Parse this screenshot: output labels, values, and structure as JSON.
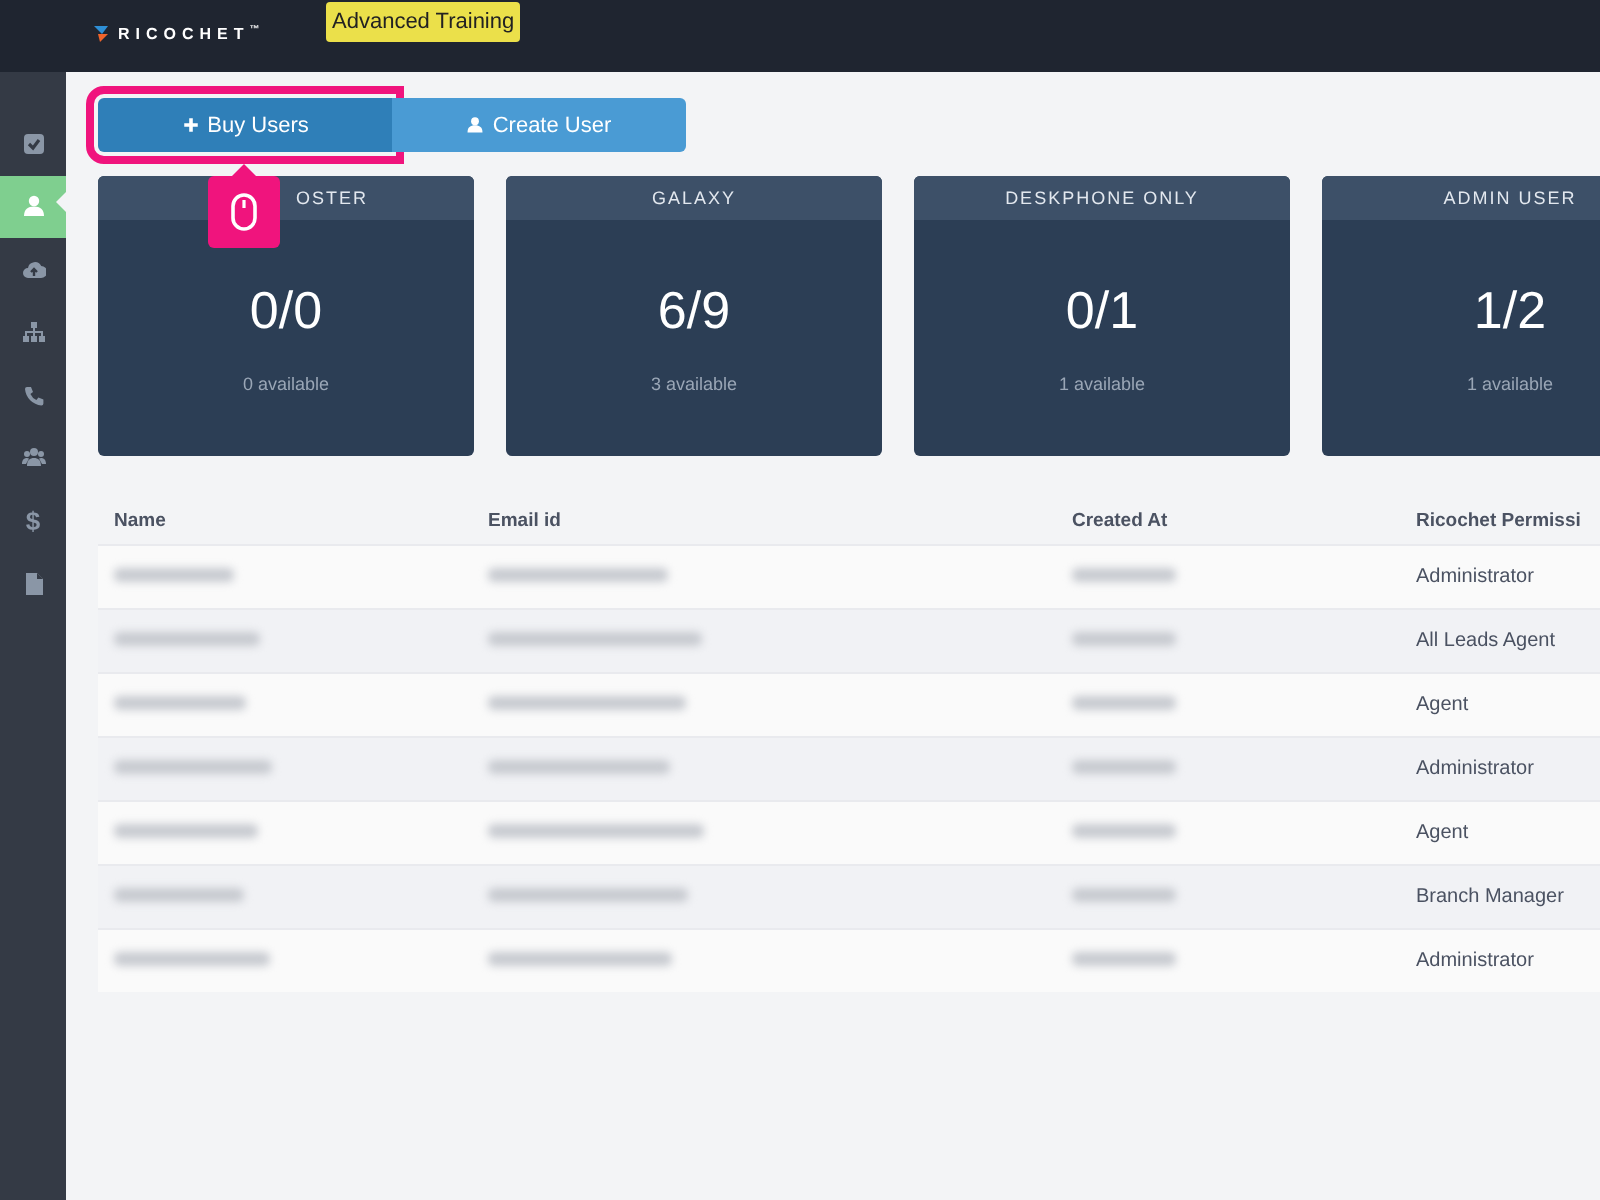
{
  "top_bar": {
    "logo": "RICOCHET",
    "logo_mark": "™",
    "badge": "Advanced Training"
  },
  "sidebar": {
    "items": [
      {
        "kind": "checkbox",
        "selected": false
      },
      {
        "kind": "user",
        "selected": true
      },
      {
        "kind": "cloud",
        "selected": false
      },
      {
        "kind": "sitemap",
        "selected": false
      },
      {
        "kind": "phone",
        "selected": false
      },
      {
        "kind": "users",
        "selected": false
      },
      {
        "kind": "glyph",
        "glyph": "$",
        "selected": false
      },
      {
        "kind": "file",
        "selected": false
      }
    ]
  },
  "actions": [
    {
      "label": "Buy Users",
      "kind": "plus",
      "highlighted": true
    },
    {
      "label": "Create User",
      "kind": "user",
      "highlighted": false
    }
  ],
  "cards": [
    {
      "title": "OSTER",
      "value": "0/0",
      "available": "0 available"
    },
    {
      "title": "GALAXY",
      "value": "6/9",
      "available": "3 available"
    },
    {
      "title": "DESKPHONE ONLY",
      "value": "0/1",
      "available": "1 available"
    },
    {
      "title": "ADMIN USER",
      "value": "1/2",
      "available": "1 available"
    }
  ],
  "table": {
    "columns": [
      "Name",
      "Email id",
      "Created At",
      "Ricochet Permissi"
    ],
    "rows": [
      {
        "permission": "Administrator"
      },
      {
        "permission": "All Leads Agent"
      },
      {
        "permission": "Agent"
      },
      {
        "permission": "Administrator"
      },
      {
        "permission": "Agent"
      },
      {
        "permission": "Branch Manager"
      },
      {
        "permission": "Administrator"
      }
    ]
  }
}
